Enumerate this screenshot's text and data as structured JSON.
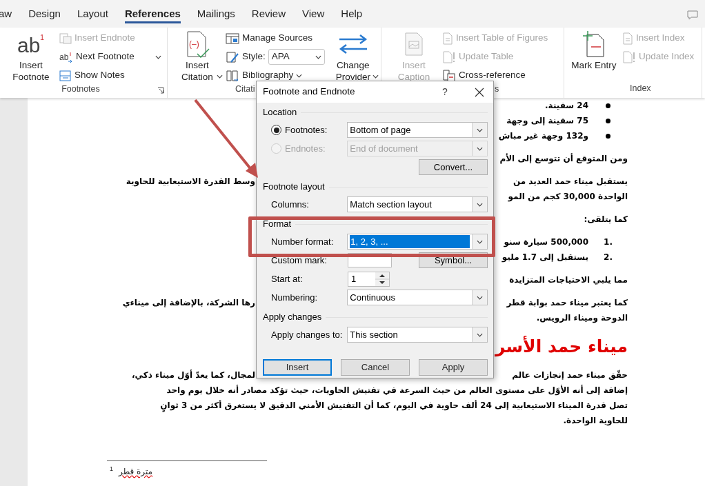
{
  "ribbon_tabs": [
    {
      "label": "aw",
      "selected": false
    },
    {
      "label": "Design",
      "selected": false
    },
    {
      "label": "Layout",
      "selected": false
    },
    {
      "label": "References",
      "selected": true
    },
    {
      "label": "Mailings",
      "selected": false
    },
    {
      "label": "Review",
      "selected": false
    },
    {
      "label": "View",
      "selected": false
    },
    {
      "label": "Help",
      "selected": false
    }
  ],
  "ribbon_groups": [
    {
      "label": "Footnotes",
      "launcher": true,
      "items": [
        {
          "kind": "large",
          "label": "Insert Footnote",
          "disabled": false,
          "dropdown": false,
          "icon_text": [
            "ab",
            "1"
          ]
        },
        {
          "kind": "small",
          "label": "Insert Endnote",
          "disabled": true,
          "dropdown": false
        },
        {
          "kind": "small",
          "label": "Next Footnote",
          "disabled": false,
          "dropdown": true,
          "icon_text": [
            "ab"
          ]
        },
        {
          "kind": "small",
          "label": "Show Notes",
          "disabled": false,
          "dropdown": false
        }
      ]
    },
    {
      "label": "Citati",
      "launcher": false,
      "items": [
        {
          "kind": "large",
          "label": "Insert Citation",
          "disabled": false,
          "dropdown": true,
          "icon_text": [
            "(–)"
          ]
        },
        {
          "kind": "small",
          "label": "Manage Sources",
          "disabled": false,
          "dropdown": false
        },
        {
          "kind": "combo",
          "label": "Style:",
          "value": "APA",
          "disabled": false,
          "dropdown": true
        },
        {
          "kind": "small",
          "label": "Bibliography",
          "disabled": false,
          "dropdown": true
        },
        {
          "kind": "large",
          "label": "Change Provider",
          "disabled": false,
          "dropdown": true
        }
      ]
    },
    {
      "label": "s",
      "launcher": false,
      "items": [
        {
          "kind": "large",
          "label": "Insert Caption",
          "disabled": true,
          "dropdown": false
        },
        {
          "kind": "small",
          "label": "Insert Table of Figures",
          "disabled": true,
          "dropdown": false
        },
        {
          "kind": "small",
          "label": "Update Table",
          "disabled": true,
          "dropdown": false
        },
        {
          "kind": "small",
          "label": "Cross-reference",
          "disabled": false,
          "dropdown": false
        }
      ]
    },
    {
      "label": "Index",
      "launcher": false,
      "items": [
        {
          "kind": "large",
          "label": "Mark Entry",
          "disabled": false,
          "dropdown": false
        },
        {
          "kind": "small",
          "label": "Insert Index",
          "disabled": true,
          "dropdown": false
        },
        {
          "kind": "small",
          "label": "Update Index",
          "disabled": true,
          "dropdown": false
        }
      ]
    }
  ],
  "document": {
    "blocks": [
      {
        "kind": "bullet",
        "lines": [
          {
            "text": "24 سفينة."
          }
        ]
      },
      {
        "kind": "bullet",
        "lines": [
          {
            "text": "75 سفينة إلى وجهة"
          }
        ]
      },
      {
        "kind": "bullet",
        "lines": [
          {
            "text": "و132 وجهة غير مباش"
          }
        ]
      },
      {
        "kind": "paragraph",
        "lines": [
          {
            "text": "ومن المتوقع أن تتوسع إلى الأم"
          }
        ]
      },
      {
        "kind": "paragraph",
        "lines": [
          {
            "text": "يستقبل ميناء حمد العديد من",
            "text_left": "وسط القدرة الاستيعابية للحاوية"
          },
          {
            "text": "الواحدة 30,000 كجم من المو"
          }
        ]
      },
      {
        "kind": "paragraph",
        "lines": [
          {
            "text": "كما يتلقى:"
          }
        ]
      },
      {
        "kind": "numbered",
        "number": "1.",
        "lines": [
          {
            "text": "500,000 سيارة سنو"
          }
        ]
      },
      {
        "kind": "numbered",
        "number": "2.",
        "lines": [
          {
            "text": "يستقبل إلى 1.7 مليو"
          }
        ]
      },
      {
        "kind": "paragraph",
        "lines": [
          {
            "text": "مما يلبي الاحتياجات المتزايدة"
          }
        ]
      },
      {
        "kind": "paragraph",
        "lines": [
          {
            "text": "كما يعتبر ميناء حمد بوابة قطر",
            "text_left": "رها الشركة، بالإضافة إلى ميناءي"
          },
          {
            "text": "الدوحة وميناء الرويس."
          }
        ]
      },
      {
        "kind": "heading",
        "lines": [
          {
            "text": "ميناء حمد الأسر"
          }
        ]
      },
      {
        "kind": "paragraph",
        "lines": [
          {
            "text": "حقّق ميناء حمد إنجازات عالم",
            "text_left": "لمجال، كما يعدّ أوّل ميناء ذكي،"
          },
          {
            "text": "إضافة إلى أنه الأوّل على مستوى العالم من حيث السرعة في تفتيش الحاويات، حيث تؤكد مصادر أنه خلال يوم واحد"
          },
          {
            "text": "تصل قدرة الميناء الاستيعابية إلى 24 ألف حاوية في اليوم، كما أن التفتيش الأمني الدقيق لا يستغرق أكثر من 3 ثوانٍ"
          },
          {
            "text": "للحاوية الواحدة."
          }
        ]
      }
    ],
    "footnote": {
      "number": "1",
      "text": "مترة قطر"
    }
  },
  "dialog": {
    "title": "Footnote and Endnote",
    "help": "?",
    "sections": [
      {
        "heading": "Location",
        "rows": [
          {
            "kind": "radio_select",
            "label": "Footnotes:",
            "checked": true,
            "disabled": false,
            "value": "Bottom of page"
          },
          {
            "kind": "radio_select",
            "label": "Endnotes:",
            "checked": false,
            "disabled": true,
            "value": "End of document"
          },
          {
            "kind": "button",
            "label": "Convert..."
          }
        ]
      },
      {
        "heading": "Footnote layout",
        "rows": [
          {
            "kind": "select",
            "label": "Columns:",
            "value": "Match section layout",
            "highlighted": false
          }
        ]
      },
      {
        "heading": "Format",
        "rows": [
          {
            "kind": "select",
            "label": "Number format:",
            "value": "1, 2, 3, ...",
            "highlighted": true
          },
          {
            "kind": "input_button",
            "label": "Custom mark:",
            "button": "Symbol..."
          },
          {
            "kind": "spinner",
            "label": "Start at:",
            "value": "1"
          },
          {
            "kind": "select",
            "label": "Numbering:",
            "value": "Continuous",
            "highlighted": false
          }
        ]
      },
      {
        "heading": "Apply changes",
        "rows": [
          {
            "kind": "select",
            "label": "Apply changes to:",
            "value": "This section",
            "highlighted": false
          }
        ]
      }
    ],
    "buttons": [
      {
        "label": "Insert",
        "default": true
      },
      {
        "label": "Cancel",
        "default": false
      },
      {
        "label": "Apply",
        "default": false
      }
    ]
  }
}
